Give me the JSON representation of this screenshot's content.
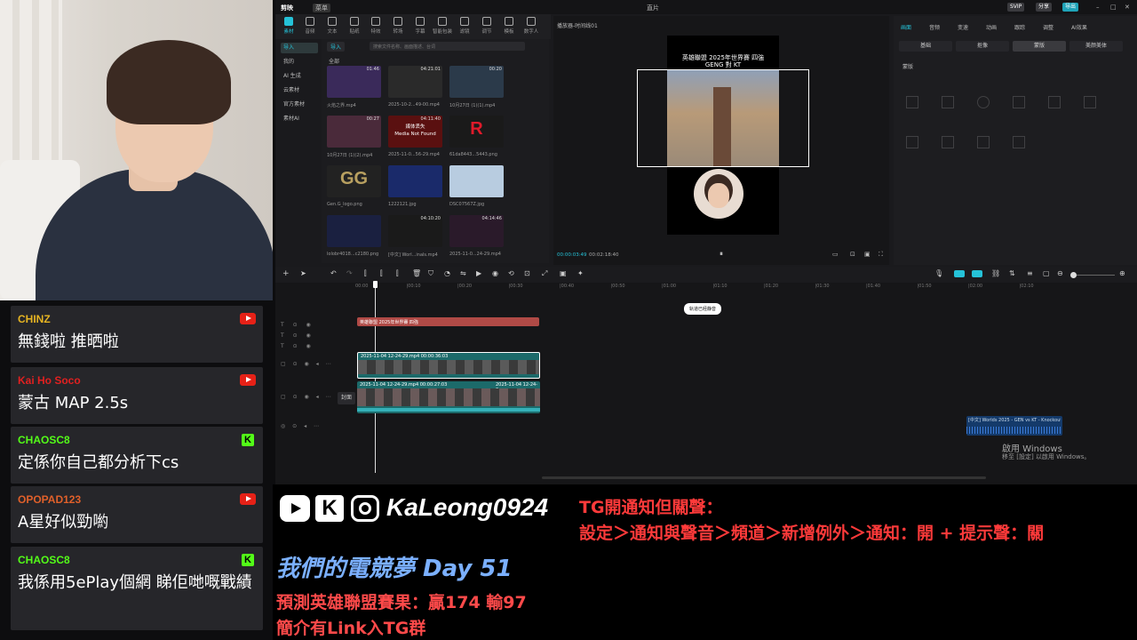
{
  "chat": [
    {
      "name": "CHINZ",
      "name_color": "#e6b422",
      "message": "無錢啦 推晒啦",
      "platform": "youtube"
    },
    {
      "name": "Kai Ho Soco",
      "name_color": "#e02020",
      "message": "蒙古 MAP 2.5s",
      "platform": "youtube"
    },
    {
      "name": "CHAOSC8",
      "name_color": "#53fc18",
      "message": "定係你自己都分析下cs",
      "platform": "kick"
    },
    {
      "name": "OPOPAD123",
      "name_color": "#e0602a",
      "message": "A星好似勁喲",
      "platform": "youtube"
    },
    {
      "name": "CHAOSC8",
      "name_color": "#53fc18",
      "message": "我係用5ePlay個網 睇佢哋嘅戰績",
      "platform": "kick"
    }
  ],
  "editor": {
    "app_logo": "剪映",
    "menu": "菜单",
    "window_title": "直片",
    "svip": "SVIP",
    "share": "分享",
    "export": "导出",
    "toolbar": [
      "素材",
      "音频",
      "文本",
      "贴纸",
      "特效",
      "转场",
      "字幕",
      "智能包装",
      "滤镜",
      "调节",
      "模板",
      "数字人"
    ],
    "side": [
      "导入",
      "我的",
      "AI 生成",
      "云素材",
      "官方素材",
      "素材AI"
    ],
    "media_import": "导入",
    "media_search_placeholder": "搜索文件名称、画面描述、台词",
    "media_all": "全部",
    "media_items": [
      {
        "label": "火焰之界.mp4",
        "dur": "01:46",
        "color": "#3a2a5a"
      },
      {
        "label": "2025-10-2...49-00.mp4",
        "dur": "04:21:01",
        "color": "#2a2a2a"
      },
      {
        "label": "10月27日 (1)(1).mp4",
        "dur": "00:20",
        "color": "#2b3a4a"
      },
      {
        "label": "10月27日 (1)(2).mp4",
        "dur": "00:27",
        "color": "#4a2a3a"
      },
      {
        "label": "2025-11-0...56-29.mp4",
        "dur": "04:11:40",
        "color": "#5a1010",
        "missing": "媒体丢失\nMedia Not Found"
      },
      {
        "label": "61da8443...5443.png",
        "dur": "",
        "color": "#1a1a1a",
        "logo": "R"
      },
      {
        "label": "Gen.G_logo.png",
        "dur": "",
        "color": "#222",
        "logo": "GG"
      },
      {
        "label": "1222121.jpg",
        "dur": "",
        "color": "#1a2a6a"
      },
      {
        "label": "DSC07567Z.jpg",
        "dur": "",
        "color": "#b8cce0"
      },
      {
        "label": "lolobr4018...c2180.png",
        "dur": "",
        "color": "#1a2040"
      },
      {
        "label": "[中文] Worl...inals.mp4",
        "dur": "04:10:20",
        "color": "#1a1a1a"
      },
      {
        "label": "2025-11-0...24-29.mp4",
        "dur": "04:14:46",
        "color": "#2a1a2a"
      }
    ],
    "player_title": "播放器-时间线01",
    "video_title": "英雄聯盟 2025年世界賽 四強",
    "video_subtitle": "GENG 對 KT",
    "time_current": "00:00:03:49",
    "time_total": "00:02:18:40",
    "props_tabs": [
      "画面",
      "音频",
      "变速",
      "动画",
      "跟踪",
      "调整",
      "AI效果"
    ],
    "props_subtabs": [
      "基础",
      "抠像",
      "蒙版",
      "美颜美体"
    ],
    "props_mask": "蒙版",
    "timeline_ruler": [
      "00:00",
      "|00:10",
      "|00:20",
      "|00:30",
      "|00:40",
      "|00:50",
      "|01:00",
      "|01:10",
      "|01:20",
      "|01:30",
      "|01:40",
      "|01:50",
      "|02:00",
      "|02:10"
    ],
    "timeline_popup": "轨道已经静音",
    "text_clip": "英雄聯盟 2025年世界賽 四強",
    "video_clip1": "2025-11-04 12-24-29.mp4  00:00:36:03",
    "video_clip2": "2025-11-04 12-24-29.mp4  00:00:27:03",
    "video_clip3": "2025-11-04 12-24-2",
    "cover_label": "封面",
    "audio_clip": "[中文] Worlds 2025 - GEN vs KT - Knockout",
    "watermark_line1": "啟用 Windows",
    "watermark_line2": "移至 [設定] 以啟用 Windows。"
  },
  "overlay": {
    "handle": "KaLeong0924",
    "tg_line1": "TG開通知但關聲：",
    "tg_line2": "設定＞通知與聲音＞頻道＞新增例外＞通知：開 + 提示聲：關",
    "dream": "我們的電競夢 Day 51",
    "predict": "預測英雄聯盟賽果：贏174 輸97",
    "intro": "簡介有Link入TG群"
  }
}
